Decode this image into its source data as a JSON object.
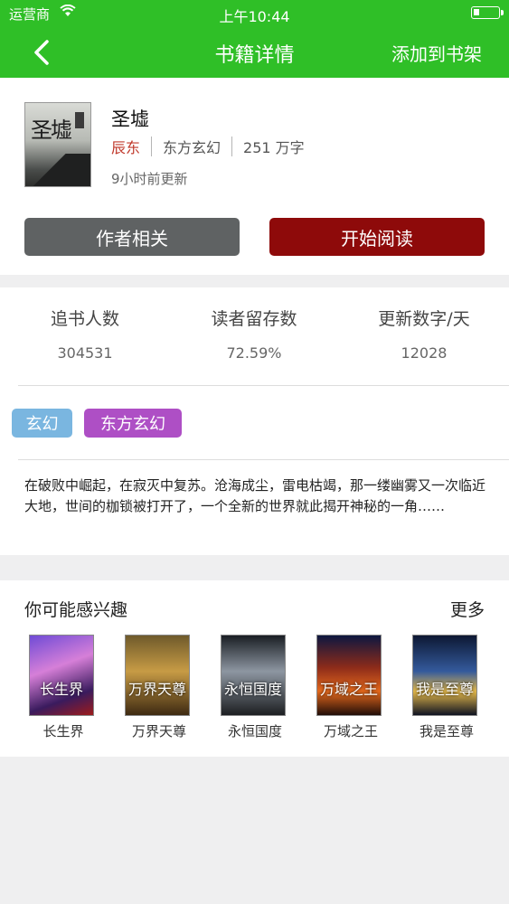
{
  "status": {
    "carrier": "运营商",
    "time": "上午10:44"
  },
  "nav": {
    "title": "书籍详情",
    "right": "添加到书架"
  },
  "book": {
    "title": "圣墟",
    "author": "辰东",
    "category": "东方玄幻",
    "word_count": "251 万字",
    "update": "9小时前更新",
    "cover_text": "圣墟"
  },
  "actions": {
    "author_label": "作者相关",
    "read_label": "开始阅读"
  },
  "stats": [
    {
      "label": "追书人数",
      "value": "304531"
    },
    {
      "label": "读者留存数",
      "value": "72.59%"
    },
    {
      "label": "更新数字/天",
      "value": "12028"
    }
  ],
  "tags": [
    "玄幻",
    "东方玄幻"
  ],
  "description": "在破败中崛起，在寂灭中复苏。沧海成尘，雷电枯竭，那一缕幽雾又一次临近大地，世间的枷锁被打开了，一个全新的世界就此揭开神秘的一角……",
  "recommend": {
    "title": "你可能感兴趣",
    "more": "更多",
    "items": [
      {
        "name": "长生界",
        "cover_text": "长生界"
      },
      {
        "name": "万界天尊",
        "cover_text": "万界天尊"
      },
      {
        "name": "永恒国度",
        "cover_text": "永恒国度"
      },
      {
        "name": "万域之王",
        "cover_text": "万域之王"
      },
      {
        "name": "我是至尊",
        "cover_text": "我是至尊"
      }
    ]
  },
  "colors": {
    "nav_green": "#2fbf27",
    "read_button": "#8e0a0a",
    "author_button": "#5f6263",
    "author_text": "#c0392b"
  }
}
